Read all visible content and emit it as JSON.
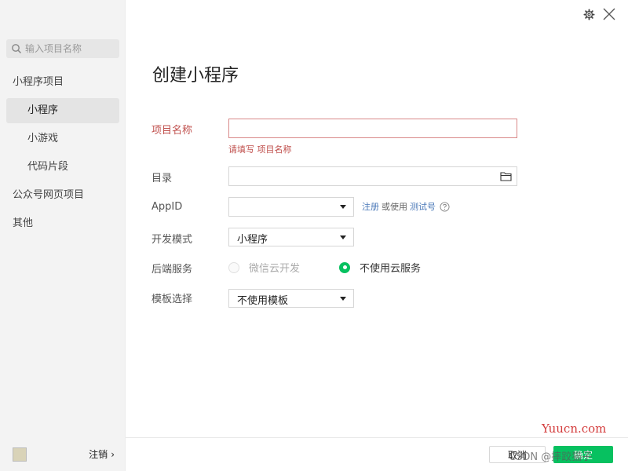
{
  "sidebar": {
    "search_placeholder": "输入项目名称",
    "items": [
      {
        "label": "小程序项目"
      },
      {
        "label": "小程序"
      },
      {
        "label": "小游戏"
      },
      {
        "label": "代码片段"
      },
      {
        "label": "公众号网页项目"
      },
      {
        "label": "其他"
      }
    ],
    "logout_label": "注销",
    "logout_chevron": "›"
  },
  "page": {
    "title": "创建小程序"
  },
  "form": {
    "name": {
      "label": "项目名称",
      "value": "",
      "error": "请填写 项目名称"
    },
    "dir": {
      "label": "目录",
      "value": ""
    },
    "appid": {
      "label": "AppID",
      "value": "",
      "register": "注册",
      "or_use": "或使用",
      "test": "测试号"
    },
    "mode": {
      "label": "开发模式",
      "value": "小程序"
    },
    "backend": {
      "label": "后端服务",
      "option1": "微信云开发",
      "option2": "不使用云服务",
      "selected": "不使用云服务"
    },
    "template": {
      "label": "模板选择",
      "value": "不使用模板"
    }
  },
  "footer": {
    "cancel": "取消",
    "confirm": "确定"
  },
  "watermark": {
    "site": "Yuucn.com",
    "csdn": "CSDN @摔跤猫子"
  },
  "colors": {
    "accent": "#07c160",
    "error": "#c0504d",
    "link": "#4a78b8"
  },
  "icons": [
    "search-icon",
    "gear-icon",
    "close-icon",
    "folder-icon",
    "help-icon",
    "chevron-right-icon",
    "caret-down-icon"
  ]
}
